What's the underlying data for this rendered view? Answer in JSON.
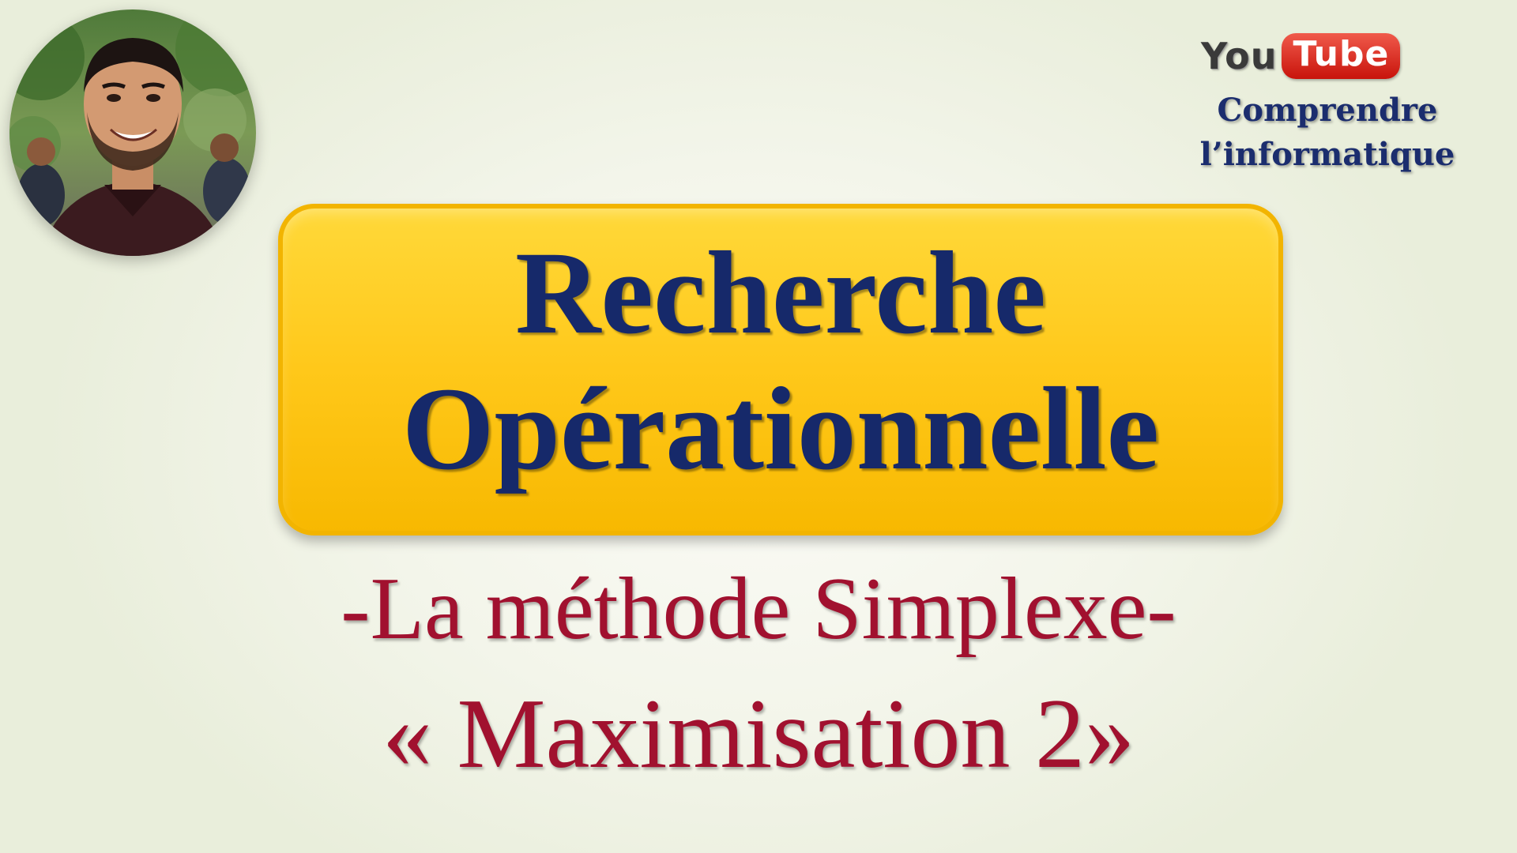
{
  "avatar": {
    "icon": "presenter-photo"
  },
  "branding": {
    "youtube_you": "You",
    "youtube_tube": "Tube",
    "channel_line1": "Comprendre",
    "channel_line2": "l’informatique",
    "colors": {
      "youtube_red": "#d62518",
      "channel_blue": "#1b2d6e"
    }
  },
  "title": {
    "line1": "Recherche",
    "line2": "Opérationnelle",
    "box_color": "#ffc81a",
    "text_color": "#16296a"
  },
  "subtitle": {
    "line1": "-La méthode Simplexe-",
    "line2": "« Maximisation 2»",
    "color": "#a1112f"
  }
}
